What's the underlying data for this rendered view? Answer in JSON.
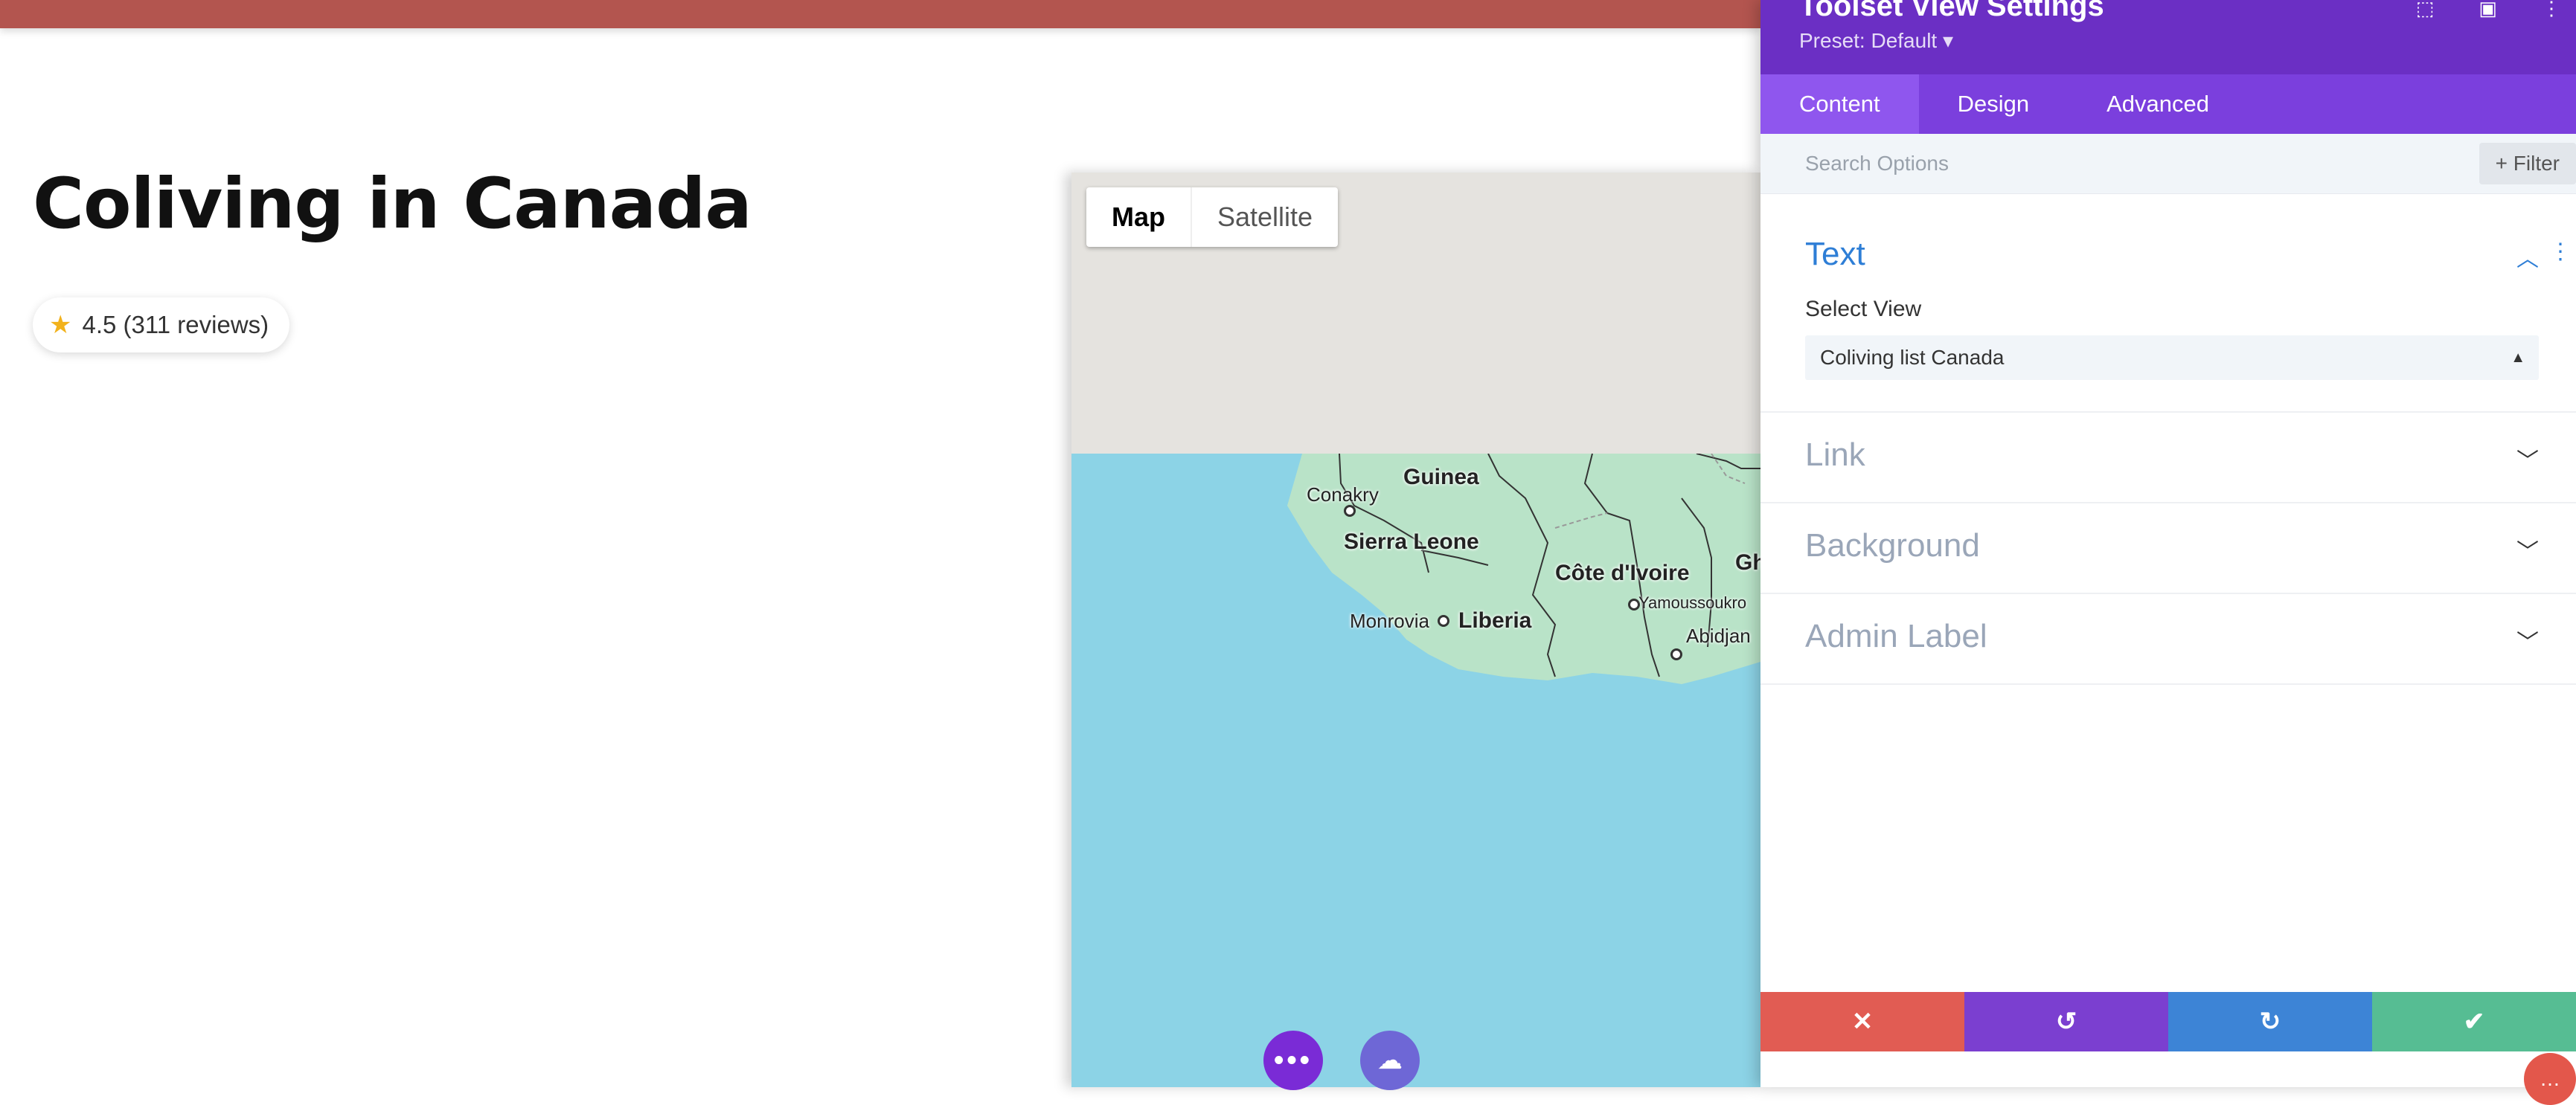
{
  "page": {
    "title": "Coliving in Canada",
    "rating": {
      "star_icon": "star-icon",
      "text": "4.5 (311 reviews)"
    }
  },
  "map": {
    "toggle": {
      "map_label": "Map",
      "satellite_label": "Satellite"
    },
    "labels": {
      "guinea": "Guinea",
      "conakry": "Conakry",
      "sierra_leone": "Sierra Leone",
      "cote_divoire": "Côte d'Ivoire",
      "gh": "Gh",
      "yamoussoukro": "Yamoussoukro",
      "monrovia": "Monrovia",
      "liberia": "Liberia",
      "abidjan": "Abidjan"
    }
  },
  "panel": {
    "title": "Toolset View Settings",
    "preset": "Preset: Default ▾",
    "tabs": [
      "Content",
      "Design",
      "Advanced"
    ],
    "search_placeholder": "Search Options",
    "filter_label": "+ Filter",
    "sections": {
      "text": {
        "title": "Text",
        "field_label": "Select View",
        "select_value": "Coliving list Canada"
      },
      "link": "Link",
      "background": "Background",
      "admin_label": "Admin Label"
    },
    "footer": {
      "close": "✕",
      "undo": "↺",
      "redo": "↻",
      "save": "✔"
    }
  },
  "colors": {
    "topbar": "#b3554f",
    "panel_header": "#6b2fc4",
    "panel_tabs": "#7b3fdd",
    "accent_blue": "#2e7ed6",
    "footer_close": "#e15c53",
    "footer_undo": "#7b3fd0",
    "footer_redo": "#3d84d6",
    "footer_save": "#56bd93"
  }
}
